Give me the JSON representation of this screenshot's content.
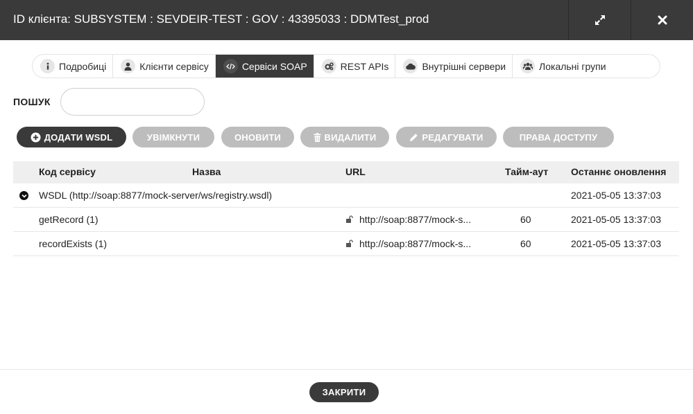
{
  "header": {
    "title": "ID клієнта: SUBSYSTEM : SEVDEIR-TEST : GOV : 43395033 : DDMTest_prod",
    "expand_icon": "expand-arrows-icon",
    "close_icon": "close-x-icon"
  },
  "tabs": [
    {
      "label": "Подробиці",
      "icon": "info-icon",
      "active": false
    },
    {
      "label": "Клієнти сервісу",
      "icon": "user-icon",
      "active": false
    },
    {
      "label": "Сервіси SOAP",
      "icon": "code-icon",
      "active": true
    },
    {
      "label": "REST APIs",
      "icon": "gears-icon",
      "active": false
    },
    {
      "label": "Внутрішні сервери",
      "icon": "cloud-icon",
      "active": false
    },
    {
      "label": "Локальні групи",
      "icon": "users-icon",
      "active": false
    }
  ],
  "search": {
    "label": "ПОШУК",
    "value": "",
    "placeholder": ""
  },
  "actions": {
    "add_wsdl": "ДОДАТИ WSDL",
    "enable": "УВІМКНУТИ",
    "refresh": "ОНОВИТИ",
    "delete": "ВИДАЛИТИ",
    "edit": "РЕДАГУВАТИ",
    "access_rights": "ПРАВА ДОСТУПУ"
  },
  "table": {
    "columns": [
      "Код сервісу",
      "Назва",
      "URL",
      "Тайм-аут",
      "Останнє оновлення"
    ],
    "wsdl_row": {
      "label": "WSDL (http://soap:8877/mock-server/ws/registry.wsdl)",
      "updated": "2021-05-05 13:37:03",
      "expanded": true
    },
    "rows": [
      {
        "code": "getRecord (1)",
        "name": "",
        "url": "http://soap:8877/mock-s...",
        "timeout": "60",
        "updated": "2021-05-05 13:37:03"
      },
      {
        "code": "recordExists (1)",
        "name": "",
        "url": "http://soap:8877/mock-s...",
        "timeout": "60",
        "updated": "2021-05-05 13:37:03"
      }
    ]
  },
  "footer": {
    "close_label": "ЗАКРИТИ"
  },
  "colors": {
    "header_bg": "#3a3a3a",
    "button_disabled": "#bdbdbd",
    "table_header_bg": "#efefef"
  }
}
